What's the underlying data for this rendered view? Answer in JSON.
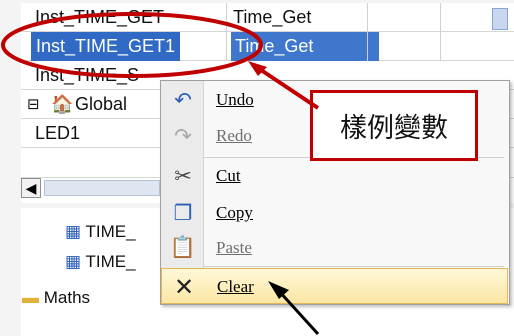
{
  "grid": {
    "rows": [
      {
        "name": "Inst_TIME_GET",
        "type": "Time_Get"
      },
      {
        "name": "Inst_TIME_GET1",
        "type": "Time_Get"
      },
      {
        "name": "Inst_TIME_S"
      },
      {
        "name": "Global"
      },
      {
        "name": "LED1"
      }
    ]
  },
  "tree": {
    "items": [
      "TIME_",
      "TIME_",
      "Maths"
    ]
  },
  "menu": {
    "items": [
      {
        "label": "Undo",
        "icon": "undo-icon",
        "enabled": true
      },
      {
        "label": "Redo",
        "icon": "redo-icon",
        "enabled": false
      },
      {
        "label": "Cut",
        "icon": "cut-icon",
        "enabled": true
      },
      {
        "label": "Copy",
        "icon": "copy-icon",
        "enabled": true
      },
      {
        "label": "Paste",
        "icon": "paste-icon",
        "enabled": false
      },
      {
        "label": "Clear",
        "icon": "clear-icon",
        "enabled": true,
        "highlighted": true
      }
    ]
  },
  "callout": {
    "text": "樣例變數"
  },
  "colors": {
    "selection": "#316ac5",
    "annotation": "#c00000",
    "menu_highlight": "#fbe6a4"
  }
}
